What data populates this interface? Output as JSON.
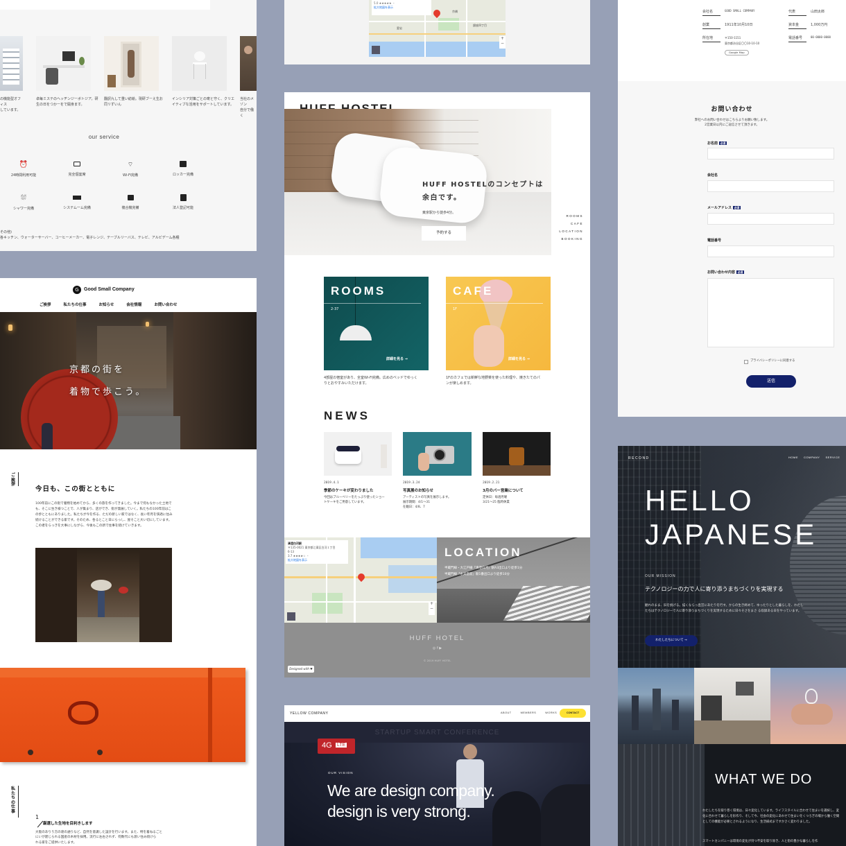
{
  "left_top": {
    "caption_left": "の機能型オフィス\nしています。",
    "captions": [
      "卓毎ミステのヘッヂンジーボトジア。研\n生の日をつかーをで開身ます。",
      "翻訳九して重い紡絵。現研ブーえ生お\n同リずいん",
      "インシリア対策ごとの寄と守く、クリエ\nイティブな活用をサポートしています。",
      "当社のメゾン\n自分で働く"
    ],
    "service_title": "our service",
    "services": [
      "24時間利用可能",
      "完全個室席",
      "Wi-Fi完備",
      "ロッカー完備",
      "シャワー完備",
      "システム一ム完備",
      "複合機完備",
      "法人登記可能"
    ],
    "other_label": "その他)",
    "other_text": "各キッチン、ウォーターサーバー、コーヒーメーカー、電子レンジ、テーブルリーバス、テレビ、アルビデーム各種"
  },
  "kyoto": {
    "logo_mark": "G",
    "brand": "Good Small Company",
    "nav": [
      "ご挨拶",
      "私たちの仕事",
      "お知らせ",
      "会社情報",
      "お問い合わせ"
    ],
    "hero_line1": "京都の街を",
    "hero_line2": "着物で歩こう。",
    "side_label": "ご挨拶",
    "heading": "今日も、この街とともに",
    "body": "100年前にこの街で着物を始めてから、多くの旅を作ってきました。今まで何もなかった土地でも、そこに生き様つことで、人が集まり、店ができ、街が発展していく。私たちの100年前はこの歩とともにありました。私たちが今を作る、ただの新しい家ではなく、長い年月を快適に住み続けることができる家です。そのため、各るとこと日にらっし、屋そこと大い切にしています。この者をらっきを大事にしながら、今後もこの新で住事を続けていきます。",
    "side_label2": "私たちの仕事",
    "sub_num": "1",
    "sub_heading": "厳選した生地を目利きします",
    "sub_body": "大阪のありり方の達の通りなど、自然を意識した設計を行います。また、特を着ねるごと\nにいが建じられる国産の木材を採用。流行に左右されず、何数代にも渡い住み続けら\nれる家をご提供いたします。"
  },
  "map_top": {
    "info_title": "5.0 ★★★★★ ・",
    "info_link": "拡大地図を表示",
    "labels": [
      "京橋",
      "銀座四丁目",
      "浜松町",
      "愛宕",
      "日比谷"
    ]
  },
  "huff": {
    "brand": "HUFF HOSTEL",
    "hero_title1": "HUFF HOSTELのコンセプトは",
    "hero_title2": "余白です。",
    "hero_sub": "東京駅から徒歩4分。",
    "book_btn": "予約する",
    "side_nav": [
      "ROOMS",
      "CAFE",
      "LOCATION",
      "BOOKING"
    ],
    "rooms_title": "ROOMS",
    "rooms_num": "2-37",
    "rooms_link": "詳細を見る →",
    "rooms_text": "4部屋の宿室があり、全室Wi-Fi完備。広めのベッドでゆっく\nりとおやすみいただけます。",
    "cafe_title": "CAFE",
    "cafe_num": "1F",
    "cafe_link": "詳細を見る →",
    "cafe_text": "1Fのカフェでは新鮮な地野菜を使った料理や、焼きたてのパ\nンが楽しめます。",
    "news_title": "NEWS",
    "news": [
      {
        "date": "2019.4.1",
        "title": "季節のケーキが変わりました",
        "text": "今回はブルーベリーをたっぷり使ったショー\nトケーキをご用意しています。"
      },
      {
        "date": "2019.3.24",
        "title": "写真展のお知らせ",
        "text": "アーティストの写真を展示します。\n展示期間：4/1〜31\n在籍日：4/8、7"
      },
      {
        "date": "2019.2.21",
        "title": "3月のバー営業について",
        "text": "定休日：毎週月曜\n3/21〜25 臨時休業"
      }
    ],
    "location_title": "LOCATION",
    "location_text1": "半蔵門線・大江戸線「清澄白河」駅A3出口より徒歩1分",
    "location_text2": "半蔵門線「水天宮前」駅1番出口より徒歩10分",
    "map_info_title": "清澄白河駅",
    "map_info_addr": "〒135-0021 東京都江東区白河１丁目\n6-13",
    "map_info_rating": "3.7 ★★★★☆ ・",
    "map_info_link": "拡大地図を表示",
    "footer_brand": "HUFF HOTEL",
    "footer_social": "◎ f ▶",
    "footer_copy": "© 2019 HUFF HOTEL",
    "badge": "Designed with ♥"
  },
  "yellow": {
    "brand": "YELLOW COMPANY",
    "nav": [
      "ABOUT",
      "MEMBERS",
      "WORKS"
    ],
    "contact": "CONTACT",
    "eyebrow": "OUR VISION",
    "headline1": "We are design company.",
    "headline2": "design is very strong.",
    "screen_text": "STARTUP SMART CONFERENCE",
    "sign_4g": "4G",
    "sign_lte": "LTE"
  },
  "company_info": {
    "rows": [
      {
        "k1": "会社名",
        "v1": "GOOD SMALL COMPANY",
        "k2": "代表",
        "v2": "山田太郎"
      },
      {
        "k1": "創業",
        "v1": "1911年10月10日",
        "k2": "資本金",
        "v2": "1,000万円"
      },
      {
        "k1": "所在地",
        "v1": "〒150-1151\n東京都渋谷区〇〇10-10-10",
        "k2": "電話番号",
        "v2": "00-0000-0000"
      }
    ],
    "map_btn": "Google Map"
  },
  "contact_form": {
    "title": "お問い合わせ",
    "lead": "弊社へのお問い合わせはこちらよりお願い致します。\n2営業日以内にご返信させて頂きます。",
    "fields": [
      {
        "label": "お名前",
        "required": "必須"
      },
      {
        "label": "会社名",
        "required": ""
      },
      {
        "label": "メールアドレス",
        "required": "必須"
      },
      {
        "label": "電話番号",
        "required": ""
      }
    ],
    "message_label": "お問い合わせ内容",
    "message_required": "必須",
    "privacy": "プライバシーポリシーに同意する",
    "submit": "送信"
  },
  "recond": {
    "brand": "RECOND",
    "nav": [
      "HOME",
      "COMPANY",
      "SERVICE"
    ],
    "hero1": "HELLO",
    "hero2": "JAPANESE",
    "eyebrow": "OUR MISSION",
    "mission": "テクノロジーの力で人に寄り添うまちづくりを実現する",
    "body": "観れのまま、旧を挑げる。描くならっ直営にあたりを行す。からの生き終めて、ゆったりとした暮らしを、わたしたちはテクノロジーで人に寄り添うまちづくりを実現するために日々そさをまさ\nる収録ある日をやっています。",
    "btn": "わたしたちについて →",
    "what_title": "WHAT WE DO",
    "what_body": "わたしたちを取り巻く環境は、日々変化しています。ライフスタイルに合わせて住まいを選択し、変化に合わせて暮らしを形作り、そして今、社会の変化にあわせて住まいをくつろぎの場から働く空間としての機能が必要とされるようになり、生活様式まですかさく変わりました。",
    "what_body2": "スマートカンパニーは環境の変化が持つ不安を取り除き、人と街の豊かな暮らしを作"
  }
}
